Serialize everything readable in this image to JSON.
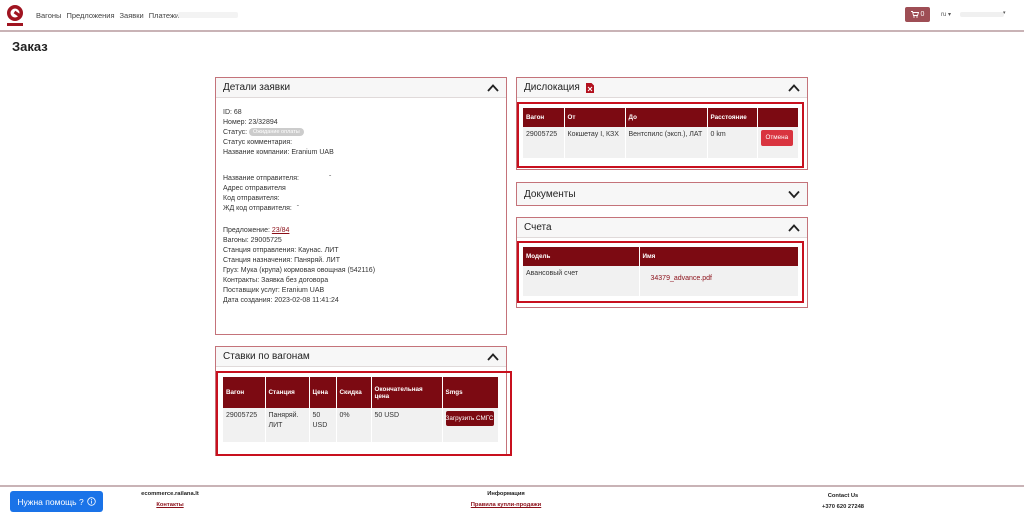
{
  "nav": {
    "links": [
      "Вагоны",
      "Предложения",
      "Заявки",
      "Платежи"
    ],
    "cart_count": "0",
    "lang": "ru"
  },
  "page_title": "Заказ",
  "details": {
    "title": "Детали заявки",
    "id": "ID: 68",
    "number": "Номер: 23/32894",
    "status_label": "Статус:",
    "status_badge": "Ожидание оплаты",
    "status_comment": "Статус комментария:",
    "company": "Название компании: Eranium UAB",
    "sender_name": "Название отправителя:",
    "sender_address": "Адрес отправителя",
    "sender_code": "Код отправителя:",
    "rail_code": "ЖД код отправителя:",
    "offer_label": "Предложение:",
    "offer_link": "23/84",
    "wagons": "Вагоны: 29005725",
    "station_from": "Станция отправления: Каунас. ЛИТ",
    "station_to": "Станция назначения: Паняряй. ЛИТ",
    "cargo": "Груз: Мука (крупа) кормовая овощная (542116)",
    "contracts": "Контракты: Заявка без договора",
    "provider": "Поставщик услуг: Eranium UAB",
    "created": "Дата создания: 2023-02-08 11:41:24"
  },
  "rates": {
    "title": "Ставки по вагонам",
    "headers": [
      "Вагон",
      "Станция",
      "Цена",
      "Скидка",
      "Окончательная цена",
      "Smgs"
    ],
    "row": {
      "wagon": "29005725",
      "station": "Паняряй. ЛИТ",
      "price": "50 USD",
      "discount": "0%",
      "final": "50 USD",
      "button": "Загрузить СМГС"
    }
  },
  "dislocation": {
    "title": "Дислокация",
    "headers": [
      "Вагон",
      "От",
      "До",
      "Расстояние",
      ""
    ],
    "row": {
      "wagon": "29005725",
      "from": "Кокшетау I, КЗХ",
      "to": "Вентспилс (эксп.), ЛАТ",
      "distance": "0 km",
      "button": "Отмена"
    }
  },
  "documents": {
    "title": "Документы"
  },
  "invoices": {
    "title": "Счета",
    "headers": [
      "Модель",
      "Имя"
    ],
    "row": {
      "model": "Авансовый счет",
      "name": "34379_advance.pdf"
    }
  },
  "footer": {
    "help": "Нужна помощь ?",
    "site": "ecommerce.railana.lt",
    "contacts": "Контакты",
    "info_title": "Информация",
    "rules": "Правила купли-продажи",
    "contact_us": "Contact Us",
    "phone": "+370 620 27248"
  },
  "colors": {
    "brand": "#7c0a12",
    "accent_frame": "#c8101e",
    "help_button": "#1a73e8"
  }
}
